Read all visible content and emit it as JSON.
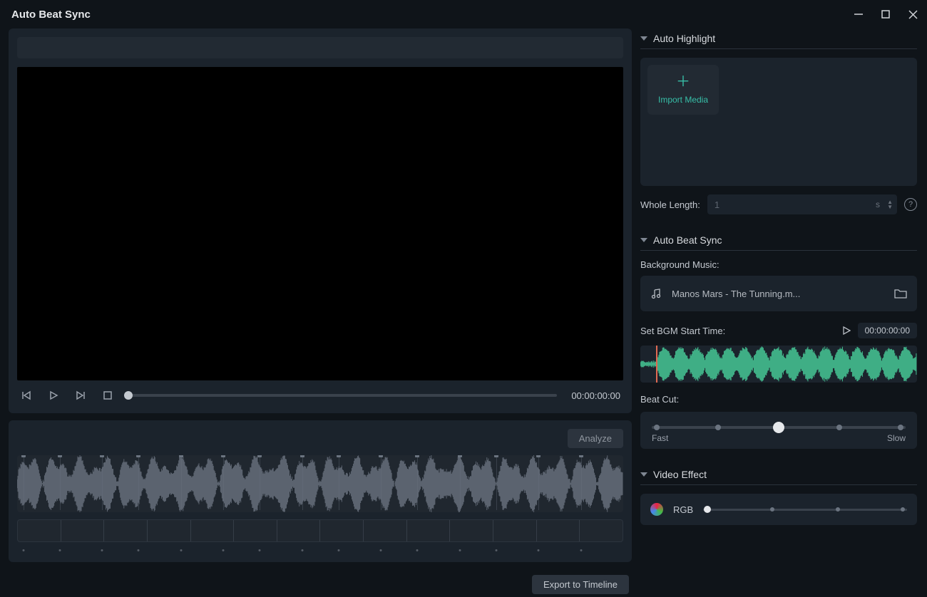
{
  "window": {
    "title": "Auto Beat Sync"
  },
  "transport": {
    "timecode": "00:00:00:00"
  },
  "timeline": {
    "analyze_label": "Analyze",
    "export_label": "Export to Timeline"
  },
  "sections": {
    "auto_highlight": "Auto Highlight",
    "auto_beat_sync": "Auto Beat Sync",
    "video_effect": "Video Effect"
  },
  "auto_highlight": {
    "import_label": "Import Media",
    "whole_length_label": "Whole Length:",
    "whole_length_value": "1",
    "whole_length_unit": "s"
  },
  "bgm": {
    "label": "Background Music:",
    "track_name": "Manos Mars - The Tunning.m...",
    "start_label": "Set BGM Start Time:",
    "start_time": "00:00:00:00"
  },
  "beat_cut": {
    "label": "Beat Cut:",
    "fast": "Fast",
    "slow": "Slow"
  },
  "video_effect": {
    "rgb_label": "RGB"
  }
}
